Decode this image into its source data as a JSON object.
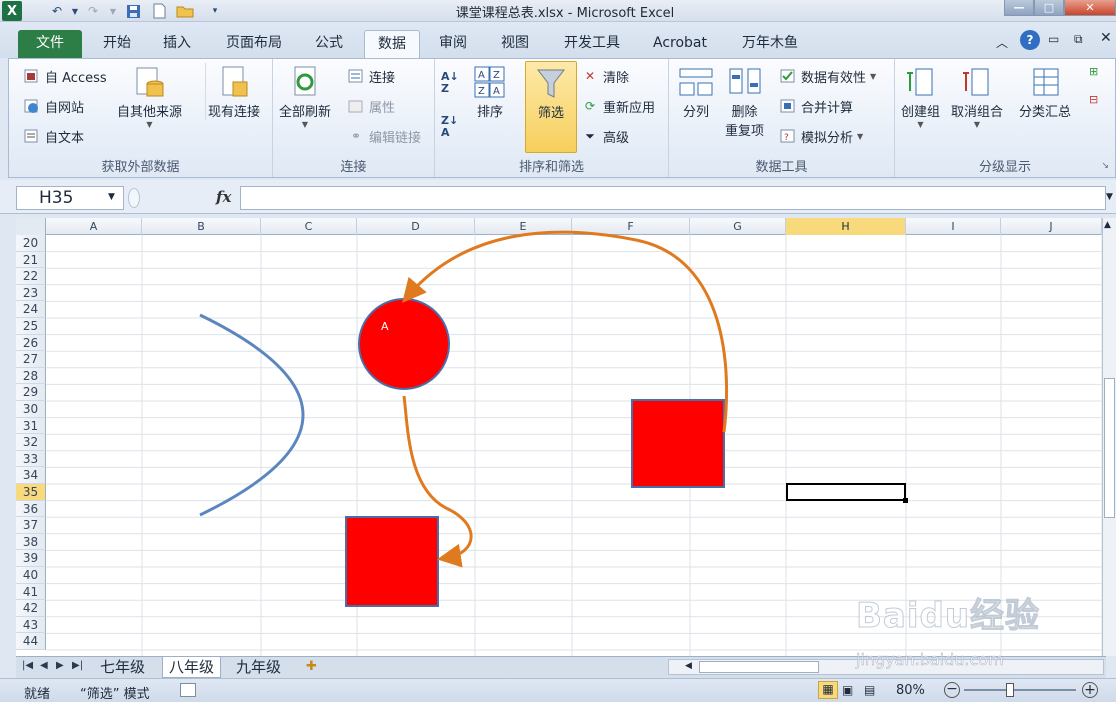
{
  "window": {
    "title": "课堂课程总表.xlsx  -  Microsoft Excel",
    "app_logo": "X"
  },
  "ribbon_tabs": [
    "文件",
    "开始",
    "插入",
    "页面布局",
    "公式",
    "数据",
    "审阅",
    "视图",
    "开发工具",
    "Acrobat",
    "万年木鱼"
  ],
  "active_tab": "数据",
  "groups": {
    "external": {
      "label": "获取外部数据",
      "access": "自 Access",
      "web": "自网站",
      "text": "自文本",
      "other": "自其他来源",
      "existing": "现有连接"
    },
    "connections": {
      "label": "连接",
      "refresh_all": "全部刷新",
      "connections": "连接",
      "properties": "属性",
      "edit_links": "编辑链接"
    },
    "sort_filter": {
      "label": "排序和筛选",
      "sort": "排序",
      "filter": "筛选",
      "clear": "清除",
      "reapply": "重新应用",
      "advanced": "高级"
    },
    "data_tools": {
      "label": "数据工具",
      "text_to_columns": "分列",
      "remove_dup_line1": "删除",
      "remove_dup_line2": "重复项",
      "validation": "数据有效性",
      "consolidate": "合并计算",
      "what_if": "模拟分析"
    },
    "outline": {
      "label": "分级显示",
      "group": "创建组",
      "ungroup": "取消组合",
      "subtotal": "分类汇总"
    }
  },
  "formula_bar": {
    "name_box": "H35",
    "fx": "fx",
    "value": ""
  },
  "columns": [
    "A",
    "B",
    "C",
    "D",
    "E",
    "F",
    "G",
    "H",
    "I",
    "J"
  ],
  "selected_column": "H",
  "rows": [
    "20",
    "21",
    "22",
    "23",
    "24",
    "25",
    "26",
    "27",
    "28",
    "29",
    "30",
    "31",
    "32",
    "33",
    "34",
    "35",
    "36",
    "37",
    "38",
    "39",
    "40",
    "41",
    "42",
    "43",
    "44"
  ],
  "selected_row": "35",
  "shapes": {
    "circle_label": "A",
    "fill_color": "#ff0000",
    "shape_border": "#4a6ea8",
    "arc_color": "#5b86bf",
    "arrow_color": "#e07a1f"
  },
  "sheets": [
    "七年级",
    "八年级",
    "九年级"
  ],
  "active_sheet": "八年级",
  "status": {
    "ready": "就绪",
    "mode": "“筛选” 模式",
    "zoom": "80%"
  },
  "watermark": {
    "brand": "Baidu经验",
    "url": "jingyan.baidu.com"
  }
}
